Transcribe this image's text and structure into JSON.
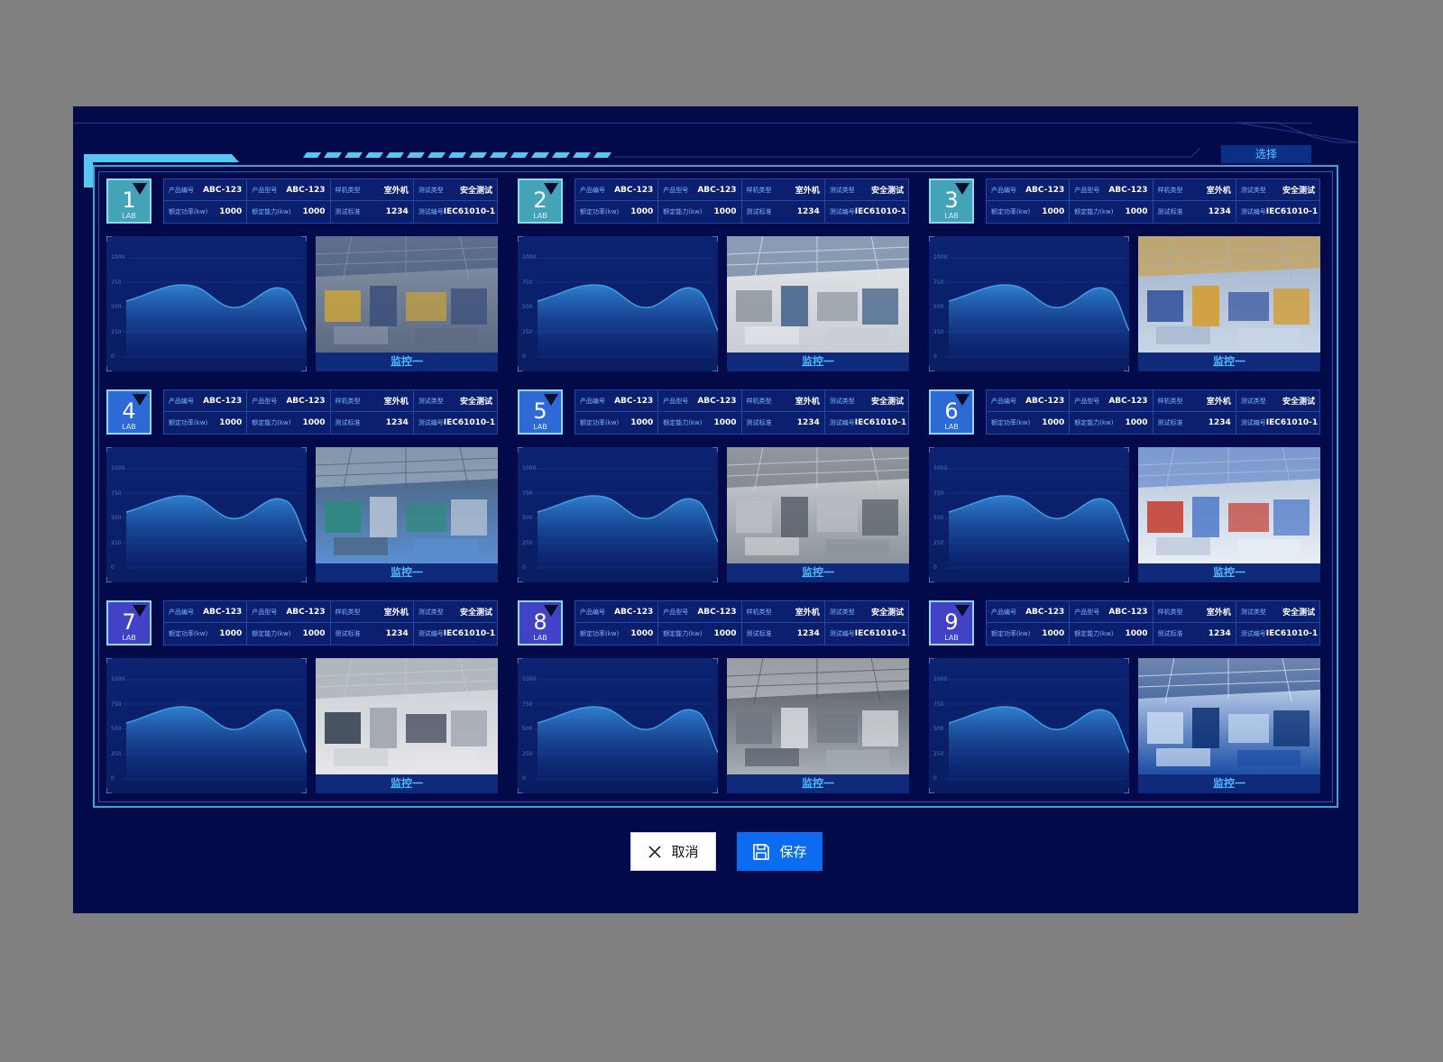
{
  "dialog": {
    "select_label": "选择",
    "cancel_label": "取消",
    "save_label": "保存",
    "cancel_icon": "close-icon",
    "save_icon": "floppy-disk-icon",
    "accent_color": "#3aa4d8",
    "background_color": "#020a4a"
  },
  "labs": [
    {
      "number": "1",
      "lab": "LAB",
      "badge_color": "#44a3b7",
      "fields": [
        {
          "k": "产品编号",
          "v": "ABC-123"
        },
        {
          "k": "产品型号",
          "v": "ABC-123"
        },
        {
          "k": "样机类型",
          "v": "室外机"
        },
        {
          "k": "测试类型",
          "v": "安全测试"
        },
        {
          "k": "额定功率(kw)",
          "v": "1000"
        },
        {
          "k": "额定能力(kw)",
          "v": "1000"
        },
        {
          "k": "测试标准",
          "v": "1234"
        },
        {
          "k": "测试编号",
          "v": "IEC61010-1"
        }
      ],
      "y_ticks": [
        "1000",
        "750",
        "500",
        "250",
        "0"
      ],
      "monitor_label": "监控一"
    },
    {
      "number": "2",
      "lab": "LAB",
      "badge_color": "#44a3b7",
      "fields": [
        {
          "k": "产品编号",
          "v": "ABC-123"
        },
        {
          "k": "产品型号",
          "v": "ABC-123"
        },
        {
          "k": "样机类型",
          "v": "室外机"
        },
        {
          "k": "测试类型",
          "v": "安全测试"
        },
        {
          "k": "额定功率(kw)",
          "v": "1000"
        },
        {
          "k": "额定能力(kw)",
          "v": "1000"
        },
        {
          "k": "测试标准",
          "v": "1234"
        },
        {
          "k": "测试编号",
          "v": "IEC61010-1"
        }
      ],
      "y_ticks": [
        "1000",
        "750",
        "500",
        "250",
        "0"
      ],
      "monitor_label": "监控一"
    },
    {
      "number": "3",
      "lab": "LAB",
      "badge_color": "#44a3b7",
      "fields": [
        {
          "k": "产品编号",
          "v": "ABC-123"
        },
        {
          "k": "产品型号",
          "v": "ABC-123"
        },
        {
          "k": "样机类型",
          "v": "室外机"
        },
        {
          "k": "测试类型",
          "v": "安全测试"
        },
        {
          "k": "额定功率(kw)",
          "v": "1000"
        },
        {
          "k": "额定能力(kw)",
          "v": "1000"
        },
        {
          "k": "测试标准",
          "v": "1234"
        },
        {
          "k": "测试编号",
          "v": "IEC61010-1"
        }
      ],
      "y_ticks": [
        "1000",
        "750",
        "500",
        "250",
        "0"
      ],
      "monitor_label": "监控一"
    },
    {
      "number": "4",
      "lab": "LAB",
      "badge_color": "#2d6ad6",
      "fields": [
        {
          "k": "产品编号",
          "v": "ABC-123"
        },
        {
          "k": "产品型号",
          "v": "ABC-123"
        },
        {
          "k": "样机类型",
          "v": "室外机"
        },
        {
          "k": "测试类型",
          "v": "安全测试"
        },
        {
          "k": "额定功率(kw)",
          "v": "1000"
        },
        {
          "k": "额定能力(kw)",
          "v": "1000"
        },
        {
          "k": "测试标准",
          "v": "1234"
        },
        {
          "k": "测试编号",
          "v": "IEC61010-1"
        }
      ],
      "y_ticks": [
        "1000",
        "750",
        "500",
        "250",
        "0"
      ],
      "monitor_label": "监控一"
    },
    {
      "number": "5",
      "lab": "LAB",
      "badge_color": "#2d6ad6",
      "fields": [
        {
          "k": "产品编号",
          "v": "ABC-123"
        },
        {
          "k": "产品型号",
          "v": "ABC-123"
        },
        {
          "k": "样机类型",
          "v": "室外机"
        },
        {
          "k": "测试类型",
          "v": "安全测试"
        },
        {
          "k": "额定功率(kw)",
          "v": "1000"
        },
        {
          "k": "额定能力(kw)",
          "v": "1000"
        },
        {
          "k": "测试标准",
          "v": "1234"
        },
        {
          "k": "测试编号",
          "v": "IEC61010-1"
        }
      ],
      "y_ticks": [
        "1000",
        "750",
        "500",
        "250",
        "0"
      ],
      "monitor_label": "监控一"
    },
    {
      "number": "6",
      "lab": "LAB",
      "badge_color": "#2d6ad6",
      "fields": [
        {
          "k": "产品编号",
          "v": "ABC-123"
        },
        {
          "k": "产品型号",
          "v": "ABC-123"
        },
        {
          "k": "样机类型",
          "v": "室外机"
        },
        {
          "k": "测试类型",
          "v": "安全测试"
        },
        {
          "k": "额定功率(kw)",
          "v": "1000"
        },
        {
          "k": "额定能力(kw)",
          "v": "1000"
        },
        {
          "k": "测试标准",
          "v": "1234"
        },
        {
          "k": "测试编号",
          "v": "IEC61010-1"
        }
      ],
      "y_ticks": [
        "1000",
        "750",
        "500",
        "250",
        "0"
      ],
      "monitor_label": "监控一"
    },
    {
      "number": "7",
      "lab": "LAB",
      "badge_color": "#4142c6",
      "fields": [
        {
          "k": "产品编号",
          "v": "ABC-123"
        },
        {
          "k": "产品型号",
          "v": "ABC-123"
        },
        {
          "k": "样机类型",
          "v": "室外机"
        },
        {
          "k": "测试类型",
          "v": "安全测试"
        },
        {
          "k": "额定功率(kw)",
          "v": "1000"
        },
        {
          "k": "额定能力(kw)",
          "v": "1000"
        },
        {
          "k": "测试标准",
          "v": "1234"
        },
        {
          "k": "测试编号",
          "v": "IEC61010-1"
        }
      ],
      "y_ticks": [
        "1000",
        "750",
        "500",
        "250",
        "0"
      ],
      "monitor_label": "监控一"
    },
    {
      "number": "8",
      "lab": "LAB",
      "badge_color": "#4142c6",
      "fields": [
        {
          "k": "产品编号",
          "v": "ABC-123"
        },
        {
          "k": "产品型号",
          "v": "ABC-123"
        },
        {
          "k": "样机类型",
          "v": "室外机"
        },
        {
          "k": "测试类型",
          "v": "安全测试"
        },
        {
          "k": "额定功率(kw)",
          "v": "1000"
        },
        {
          "k": "额定能力(kw)",
          "v": "1000"
        },
        {
          "k": "测试标准",
          "v": "1234"
        },
        {
          "k": "测试编号",
          "v": "IEC61010-1"
        }
      ],
      "y_ticks": [
        "1000",
        "750",
        "500",
        "250",
        "0"
      ],
      "monitor_label": "监控一"
    },
    {
      "number": "9",
      "lab": "LAB",
      "badge_color": "#4142c6",
      "fields": [
        {
          "k": "产品编号",
          "v": "ABC-123"
        },
        {
          "k": "产品型号",
          "v": "ABC-123"
        },
        {
          "k": "样机类型",
          "v": "室外机"
        },
        {
          "k": "测试类型",
          "v": "安全测试"
        },
        {
          "k": "额定功率(kw)",
          "v": "1000"
        },
        {
          "k": "额定能力(kw)",
          "v": "1000"
        },
        {
          "k": "测试标准",
          "v": "1234"
        },
        {
          "k": "测试编号",
          "v": "IEC61010-1"
        }
      ],
      "y_ticks": [
        "1000",
        "750",
        "500",
        "250",
        "0"
      ],
      "monitor_label": "监控一"
    }
  ]
}
